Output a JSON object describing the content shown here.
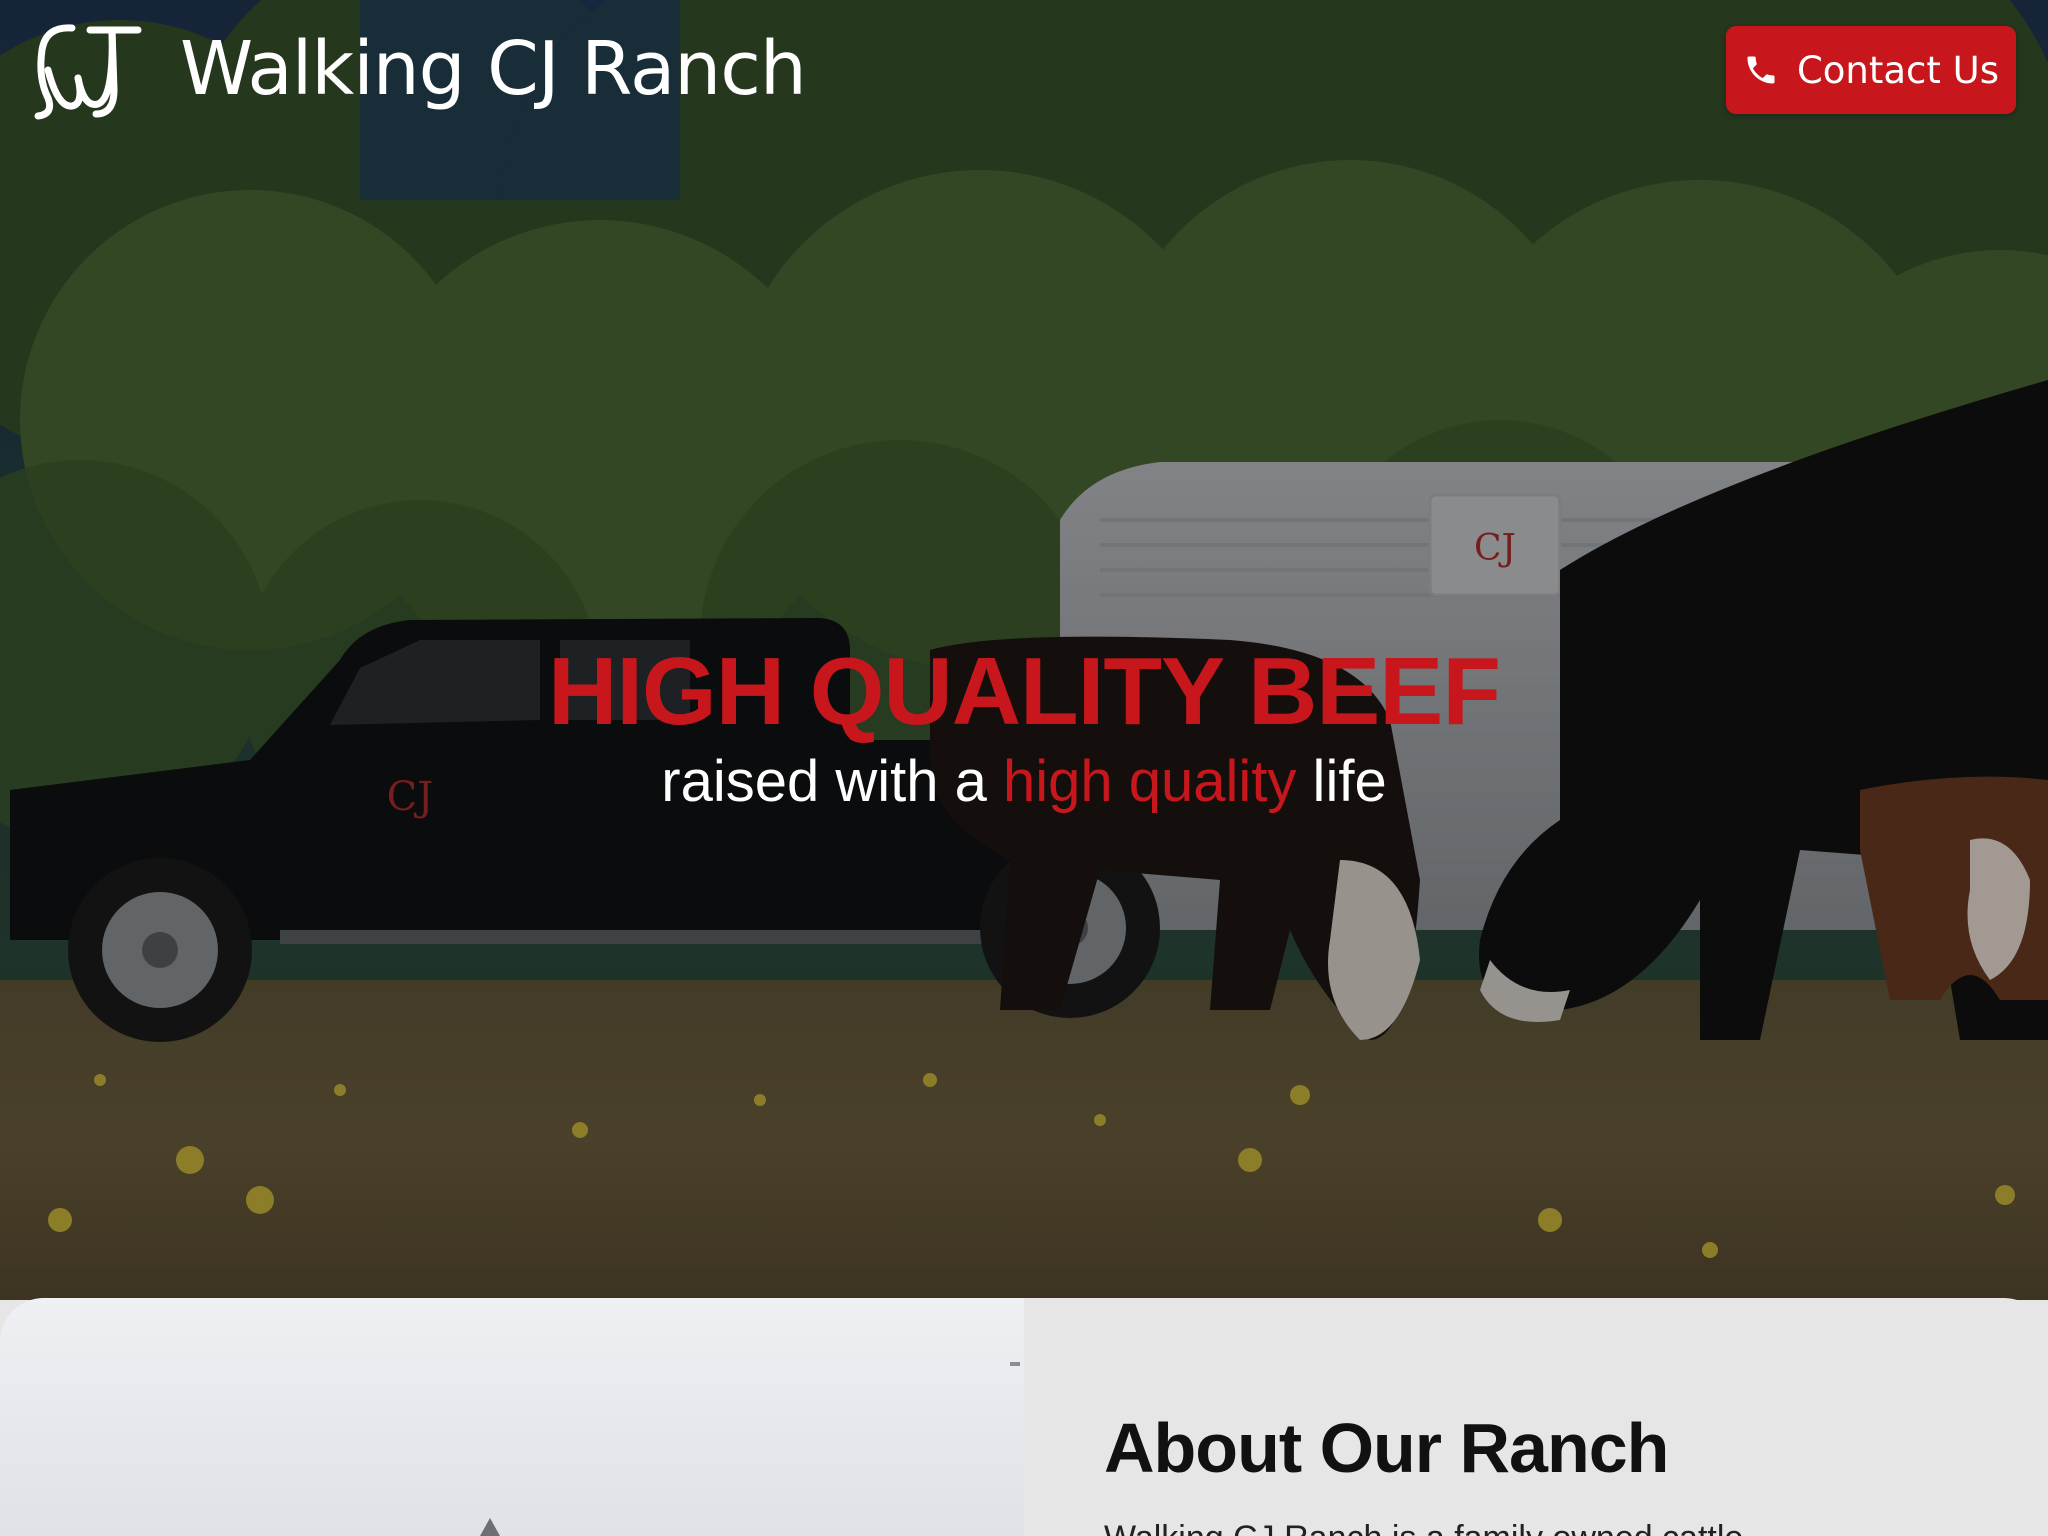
{
  "header": {
    "site_title": "Walking CJ Ranch",
    "logo_icon": "cj-brand-logo",
    "contact_button": {
      "label": "Contact Us",
      "icon": "phone-icon"
    }
  },
  "hero": {
    "headline": "HIGH QUALITY BEEF",
    "subline_before": "raised with a ",
    "subline_accent": "high quality",
    "subline_after": " life",
    "photo_description": "black pickup truck with livestock trailer and grazing cattle in a field"
  },
  "about": {
    "title": "About Our Ranch",
    "body_partial": "Walking CJ Ranch is a family owned cattle"
  },
  "colors": {
    "accent_red": "#c8171c",
    "text_white": "#ffffff",
    "section_bg": "#e6e6e6",
    "heading_dark": "#111111"
  }
}
